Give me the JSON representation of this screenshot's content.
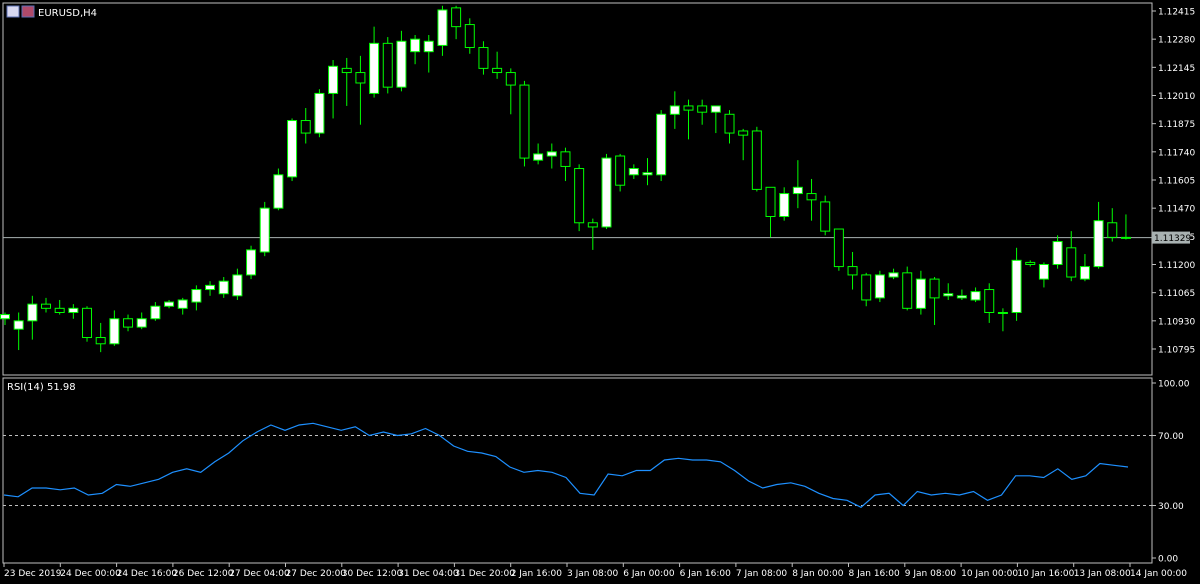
{
  "main_chart": {
    "symbol": "EURUSD,H4",
    "price_ticks": [
      "1.12415",
      "1.12280",
      "1.12145",
      "1.12010",
      "1.11875",
      "1.11740",
      "1.11605",
      "1.11470",
      "1.11335",
      "1.11200",
      "1.11065",
      "1.10930",
      "1.10795"
    ],
    "current_price": "1.11329"
  },
  "rsi": {
    "label": "RSI(14) 51.98",
    "levels": [
      "100.00",
      "70.00",
      "30.00",
      "0.00"
    ]
  },
  "time_labels": [
    "23 Dec 2019",
    "24 Dec 00:00",
    "24 Dec 16:00",
    "26 Dec 12:00",
    "27 Dec 04:00",
    "27 Dec 20:00",
    "30 Dec 12:00",
    "31 Dec 04:00",
    "31 Dec 20:00",
    "2 Jan 16:00",
    "3 Jan 08:00",
    "6 Jan 00:00",
    "6 Jan 16:00",
    "7 Jan 08:00",
    "8 Jan 00:00",
    "8 Jan 16:00",
    "9 Jan 08:00",
    "10 Jan 00:00",
    "10 Jan 16:00",
    "13 Jan 08:00",
    "14 Jan 00:00"
  ],
  "colors": {
    "background": "#000000",
    "bull_body": "#ffffff",
    "bear_body": "#000000",
    "candle_outline": "#00ff00",
    "rsi_line": "#1e90ff",
    "axis_text": "#ffffff",
    "price_line": "#a9b2b2"
  },
  "chart_data": [
    {
      "type": "candlestick",
      "title": "EURUSD,H4",
      "ylim": [
        1.1071,
        1.125
      ],
      "candles": [
        {
          "o": 1.1094,
          "h": 1.1097,
          "l": 1.1091,
          "c": 1.1096
        },
        {
          "o": 1.1089,
          "h": 1.1097,
          "l": 1.1079,
          "c": 1.1093
        },
        {
          "o": 1.1093,
          "h": 1.1105,
          "l": 1.1084,
          "c": 1.1101
        },
        {
          "o": 1.1101,
          "h": 1.1104,
          "l": 1.1097,
          "c": 1.1099
        },
        {
          "o": 1.1099,
          "h": 1.1103,
          "l": 1.1096,
          "c": 1.1097
        },
        {
          "o": 1.1097,
          "h": 1.1101,
          "l": 1.1094,
          "c": 1.1099
        },
        {
          "o": 1.1099,
          "h": 1.11,
          "l": 1.1083,
          "c": 1.1085
        },
        {
          "o": 1.1085,
          "h": 1.1092,
          "l": 1.1078,
          "c": 1.1082
        },
        {
          "o": 1.1082,
          "h": 1.1098,
          "l": 1.1081,
          "c": 1.1094
        },
        {
          "o": 1.1094,
          "h": 1.1096,
          "l": 1.1088,
          "c": 1.109
        },
        {
          "o": 1.109,
          "h": 1.1097,
          "l": 1.1089,
          "c": 1.1094
        },
        {
          "o": 1.1094,
          "h": 1.1102,
          "l": 1.1093,
          "c": 1.11
        },
        {
          "o": 1.11,
          "h": 1.1103,
          "l": 1.1099,
          "c": 1.1102
        },
        {
          "o": 1.1099,
          "h": 1.1104,
          "l": 1.1096,
          "c": 1.1103
        },
        {
          "o": 1.1102,
          "h": 1.111,
          "l": 1.1098,
          "c": 1.1108
        },
        {
          "o": 1.1108,
          "h": 1.1112,
          "l": 1.1105,
          "c": 1.111
        },
        {
          "o": 1.1106,
          "h": 1.1114,
          "l": 1.1104,
          "c": 1.1112
        },
        {
          "o": 1.1105,
          "h": 1.1118,
          "l": 1.1103,
          "c": 1.1115
        },
        {
          "o": 1.1115,
          "h": 1.1129,
          "l": 1.1113,
          "c": 1.1127
        },
        {
          "o": 1.1126,
          "h": 1.115,
          "l": 1.1124,
          "c": 1.1147
        },
        {
          "o": 1.1147,
          "h": 1.1166,
          "l": 1.1146,
          "c": 1.1163
        },
        {
          "o": 1.1162,
          "h": 1.119,
          "l": 1.116,
          "c": 1.1189
        },
        {
          "o": 1.1189,
          "h": 1.1195,
          "l": 1.1178,
          "c": 1.1183
        },
        {
          "o": 1.1183,
          "h": 1.1204,
          "l": 1.1181,
          "c": 1.1202
        },
        {
          "o": 1.1202,
          "h": 1.1218,
          "l": 1.119,
          "c": 1.1215
        },
        {
          "o": 1.1214,
          "h": 1.1219,
          "l": 1.1196,
          "c": 1.1212
        },
        {
          "o": 1.1212,
          "h": 1.122,
          "l": 1.1187,
          "c": 1.1207
        },
        {
          "o": 1.1202,
          "h": 1.1234,
          "l": 1.12,
          "c": 1.1226
        },
        {
          "o": 1.1226,
          "h": 1.1229,
          "l": 1.1202,
          "c": 1.1205
        },
        {
          "o": 1.1205,
          "h": 1.1232,
          "l": 1.1203,
          "c": 1.1227
        },
        {
          "o": 1.1222,
          "h": 1.123,
          "l": 1.1216,
          "c": 1.1228
        },
        {
          "o": 1.1222,
          "h": 1.123,
          "l": 1.1212,
          "c": 1.1227
        },
        {
          "o": 1.1225,
          "h": 1.1244,
          "l": 1.122,
          "c": 1.1242
        },
        {
          "o": 1.1243,
          "h": 1.1244,
          "l": 1.1228,
          "c": 1.1234
        },
        {
          "o": 1.1235,
          "h": 1.1238,
          "l": 1.1221,
          "c": 1.1224
        },
        {
          "o": 1.1224,
          "h": 1.1227,
          "l": 1.1211,
          "c": 1.1214
        },
        {
          "o": 1.1214,
          "h": 1.1222,
          "l": 1.1209,
          "c": 1.1212
        },
        {
          "o": 1.1212,
          "h": 1.1214,
          "l": 1.1192,
          "c": 1.1206
        },
        {
          "o": 1.1206,
          "h": 1.1208,
          "l": 1.1167,
          "c": 1.1171
        },
        {
          "o": 1.117,
          "h": 1.1178,
          "l": 1.1168,
          "c": 1.1173
        },
        {
          "o": 1.1172,
          "h": 1.1178,
          "l": 1.1166,
          "c": 1.1174
        },
        {
          "o": 1.1174,
          "h": 1.1176,
          "l": 1.116,
          "c": 1.1167
        },
        {
          "o": 1.1166,
          "h": 1.1168,
          "l": 1.1136,
          "c": 1.114
        },
        {
          "o": 1.114,
          "h": 1.1142,
          "l": 1.1127,
          "c": 1.1138
        },
        {
          "o": 1.1138,
          "h": 1.1173,
          "l": 1.1137,
          "c": 1.1171
        },
        {
          "o": 1.1172,
          "h": 1.1173,
          "l": 1.1155,
          "c": 1.1158
        },
        {
          "o": 1.1163,
          "h": 1.1168,
          "l": 1.1161,
          "c": 1.1166
        },
        {
          "o": 1.1163,
          "h": 1.1171,
          "l": 1.1158,
          "c": 1.1164
        },
        {
          "o": 1.1163,
          "h": 1.1194,
          "l": 1.116,
          "c": 1.1192
        },
        {
          "o": 1.1192,
          "h": 1.1203,
          "l": 1.1185,
          "c": 1.1196
        },
        {
          "o": 1.1196,
          "h": 1.1199,
          "l": 1.118,
          "c": 1.1194
        },
        {
          "o": 1.1196,
          "h": 1.1199,
          "l": 1.1187,
          "c": 1.1193
        },
        {
          "o": 1.1193,
          "h": 1.1196,
          "l": 1.1183,
          "c": 1.1196
        },
        {
          "o": 1.1192,
          "h": 1.1194,
          "l": 1.1178,
          "c": 1.1183
        },
        {
          "o": 1.1184,
          "h": 1.1185,
          "l": 1.117,
          "c": 1.1182
        },
        {
          "o": 1.1184,
          "h": 1.1186,
          "l": 1.1155,
          "c": 1.1156
        },
        {
          "o": 1.1157,
          "h": 1.1157,
          "l": 1.1133,
          "c": 1.1143
        },
        {
          "o": 1.1143,
          "h": 1.1157,
          "l": 1.1141,
          "c": 1.1154
        },
        {
          "o": 1.1154,
          "h": 1.117,
          "l": 1.1147,
          "c": 1.1157
        },
        {
          "o": 1.1154,
          "h": 1.1161,
          "l": 1.1141,
          "c": 1.1151
        },
        {
          "o": 1.115,
          "h": 1.1153,
          "l": 1.1134,
          "c": 1.1136
        },
        {
          "o": 1.1137,
          "h": 1.1137,
          "l": 1.1117,
          "c": 1.1119
        },
        {
          "o": 1.1119,
          "h": 1.1126,
          "l": 1.1108,
          "c": 1.1115
        },
        {
          "o": 1.1115,
          "h": 1.1116,
          "l": 1.11,
          "c": 1.1103
        },
        {
          "o": 1.1104,
          "h": 1.1117,
          "l": 1.1102,
          "c": 1.1115
        },
        {
          "o": 1.1114,
          "h": 1.1118,
          "l": 1.1113,
          "c": 1.1116
        },
        {
          "o": 1.1116,
          "h": 1.1119,
          "l": 1.1098,
          "c": 1.1099
        },
        {
          "o": 1.1099,
          "h": 1.1117,
          "l": 1.1096,
          "c": 1.1113
        },
        {
          "o": 1.1113,
          "h": 1.1114,
          "l": 1.1091,
          "c": 1.1104
        },
        {
          "o": 1.1105,
          "h": 1.1111,
          "l": 1.1103,
          "c": 1.1106
        },
        {
          "o": 1.1104,
          "h": 1.1108,
          "l": 1.1103,
          "c": 1.1105
        },
        {
          "o": 1.1103,
          "h": 1.1109,
          "l": 1.1102,
          "c": 1.1107
        },
        {
          "o": 1.1108,
          "h": 1.1111,
          "l": 1.1092,
          "c": 1.1097
        },
        {
          "o": 1.1097,
          "h": 1.1099,
          "l": 1.1088,
          "c": 1.1097
        },
        {
          "o": 1.1097,
          "h": 1.1128,
          "l": 1.1093,
          "c": 1.1122
        },
        {
          "o": 1.1121,
          "h": 1.1122,
          "l": 1.1119,
          "c": 1.112
        },
        {
          "o": 1.1113,
          "h": 1.1121,
          "l": 1.1109,
          "c": 1.112
        },
        {
          "o": 1.112,
          "h": 1.1134,
          "l": 1.1118,
          "c": 1.1131
        },
        {
          "o": 1.1128,
          "h": 1.1136,
          "l": 1.1112,
          "c": 1.1114
        },
        {
          "o": 1.1113,
          "h": 1.1125,
          "l": 1.1112,
          "c": 1.1119
        },
        {
          "o": 1.1119,
          "h": 1.115,
          "l": 1.1118,
          "c": 1.1141
        },
        {
          "o": 1.114,
          "h": 1.1147,
          "l": 1.1131,
          "c": 1.1133
        },
        {
          "o": 1.1133,
          "h": 1.1144,
          "l": 1.1132,
          "c": 1.1133
        }
      ]
    },
    {
      "type": "line",
      "title": "RSI(14) 51.98",
      "ylim": [
        0,
        100
      ],
      "levels": [
        70,
        30
      ],
      "values": [
        36,
        35,
        40,
        40,
        39,
        40,
        36,
        37,
        42,
        41,
        43,
        45,
        49,
        51,
        49,
        55,
        60,
        67,
        72,
        76,
        73,
        76,
        77,
        75,
        73,
        75,
        70,
        72,
        70,
        71,
        74,
        70,
        64,
        61,
        60,
        58,
        52,
        49,
        50,
        49,
        46,
        37,
        36,
        48,
        47,
        50,
        50,
        56,
        57,
        56,
        56,
        55,
        50,
        44,
        40,
        42,
        43,
        41,
        37,
        34,
        33,
        29,
        36,
        37,
        30,
        38,
        36,
        37,
        36,
        38,
        33,
        36,
        47,
        47,
        46,
        51,
        45,
        47,
        54,
        53,
        52
      ]
    }
  ]
}
